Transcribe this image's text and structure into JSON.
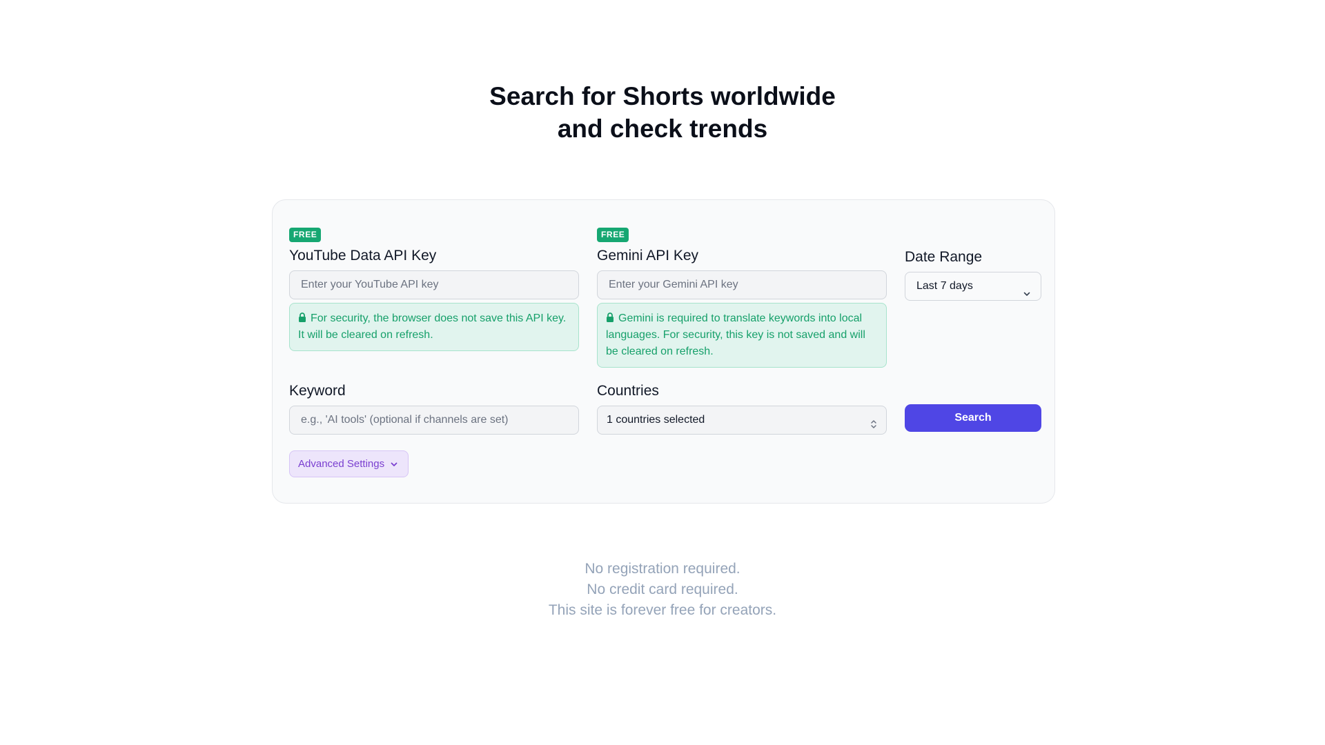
{
  "hero": {
    "line1": "Search for Shorts worldwide",
    "line2": "and check trends"
  },
  "form": {
    "youtube": {
      "badge": "FREE",
      "label": "YouTube Data API Key",
      "placeholder": "Enter your YouTube API key",
      "notice": "For security, the browser does not save this API key. It will be cleared on refresh."
    },
    "gemini": {
      "badge": "FREE",
      "label": "Gemini API Key",
      "placeholder": "Enter your Gemini API key",
      "notice": "Gemini is required to translate keywords into local languages. For security, this key is not saved and will be cleared on refresh."
    },
    "date_range": {
      "label": "Date Range",
      "selected": "Last 7 days"
    },
    "keyword": {
      "label": "Keyword",
      "placeholder": "e.g., 'AI tools' (optional if channels are set)"
    },
    "countries": {
      "label": "Countries",
      "selected": "1 countries selected"
    },
    "search_label": "Search",
    "advanced_label": "Advanced Settings"
  },
  "footer": {
    "line1": "No registration required.",
    "line2": "No credit card required.",
    "line3": "This site is forever free for creators."
  },
  "colors": {
    "primary": "#4f46e5",
    "badge": "#16a772",
    "notice_bg": "#e1f4ee",
    "notice_text": "#16a06a",
    "advanced_bg": "#ede5fb",
    "advanced_text": "#7a3fd0",
    "muted_text": "#94a3b8"
  },
  "icons": {
    "notice": "lock-icon",
    "date_select": "chevron-down-icon",
    "countries_select": "chevron-updown-icon",
    "advanced": "chevron-down-icon"
  }
}
